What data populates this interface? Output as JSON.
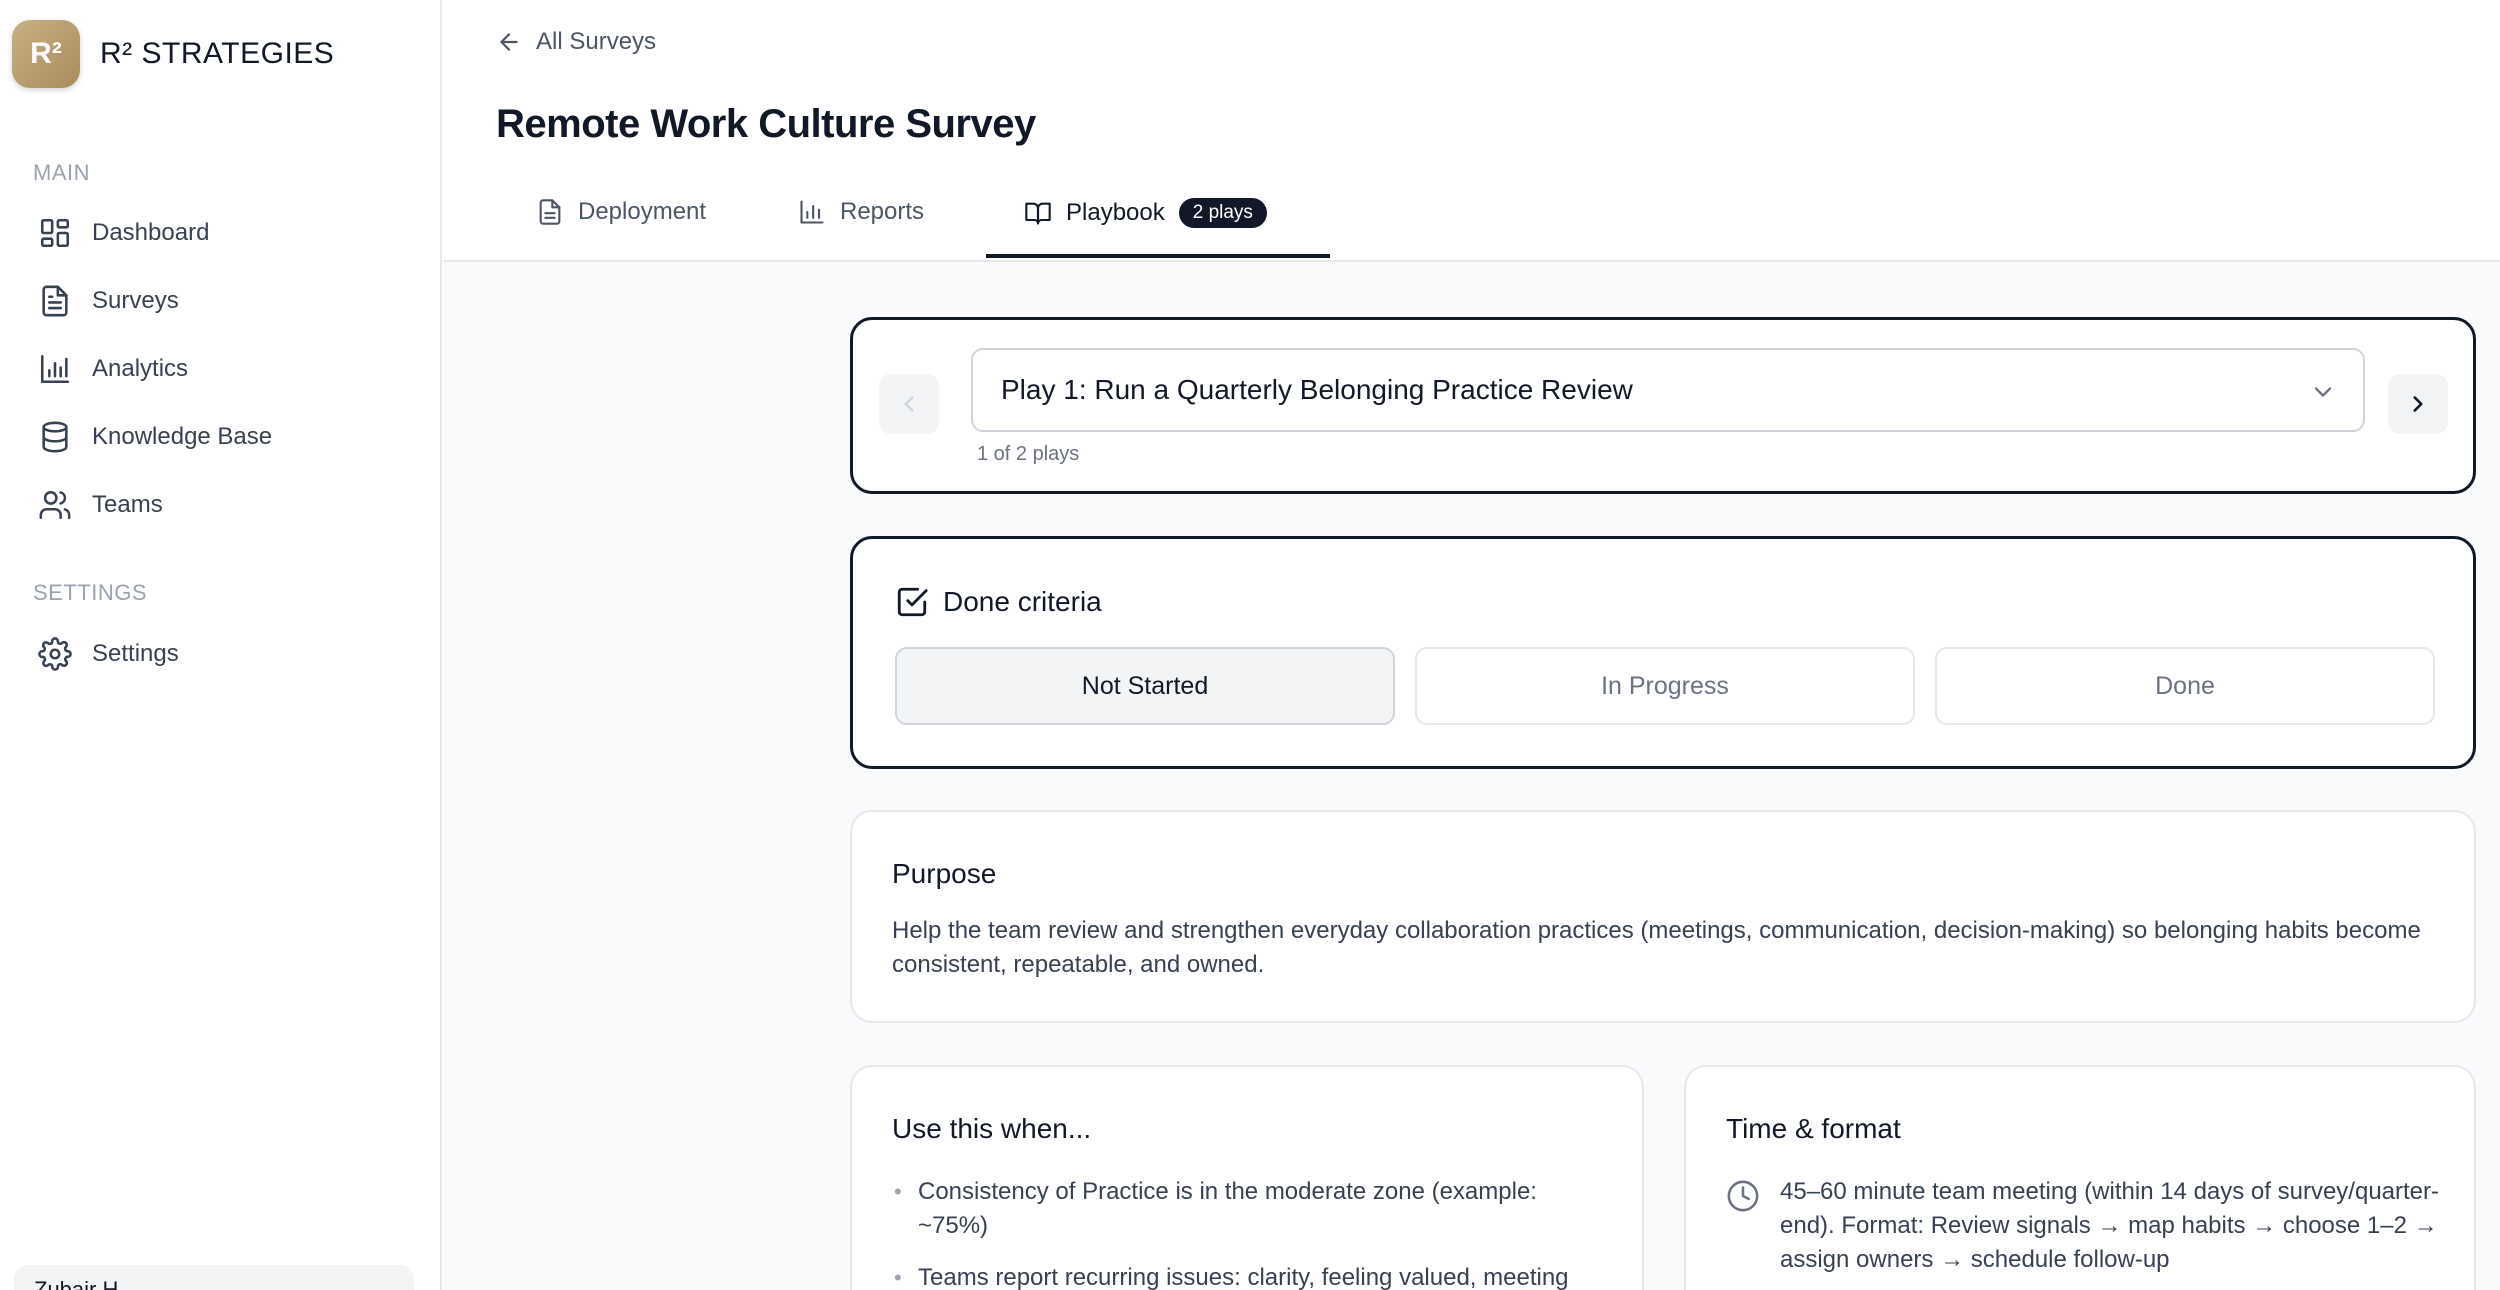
{
  "brand": {
    "logo_text": "R²",
    "name": "R² STRATEGIES"
  },
  "sidebar": {
    "main_section": "MAIN",
    "items": [
      {
        "label": "Dashboard",
        "icon": "dashboard-icon"
      },
      {
        "label": "Surveys",
        "icon": "document-icon"
      },
      {
        "label": "Analytics",
        "icon": "bar-chart-icon"
      },
      {
        "label": "Knowledge Base",
        "icon": "database-icon"
      },
      {
        "label": "Teams",
        "icon": "users-icon"
      }
    ],
    "settings_section": "SETTINGS",
    "settings_items": [
      {
        "label": "Settings",
        "icon": "gear-icon"
      }
    ],
    "user_name": "Zubair H..."
  },
  "header": {
    "back_label": "All Surveys",
    "title": "Remote Work Culture Survey",
    "tabs": [
      {
        "label": "Deployment",
        "icon": "document-icon"
      },
      {
        "label": "Reports",
        "icon": "bar-chart-icon"
      },
      {
        "label": "Playbook",
        "icon": "book-icon",
        "badge": "2 plays",
        "active": true
      }
    ]
  },
  "play_selector": {
    "selected": "Play 1: Run a Quarterly Belonging Practice Review",
    "count_text": "1 of 2 plays"
  },
  "done_criteria": {
    "title": "Done criteria",
    "options": [
      "Not Started",
      "In Progress",
      "Done"
    ],
    "selected": "Not Started"
  },
  "purpose": {
    "title": "Purpose",
    "text": "Help the team review and strengthen everyday collaboration practices (meetings, communication, decision-making) so belonging habits become consistent, repeatable, and owned."
  },
  "use_when": {
    "title": "Use this when...",
    "items": [
      "Consistency of Practice is in the moderate zone (example: ~75%)",
      "Teams report recurring issues: clarity, feeling valued, meeting"
    ]
  },
  "time_format": {
    "title": "Time & format",
    "text": "45–60 minute team meeting (within 14 days of survey/quarter-end). Format: Review signals → map habits → choose 1–2 → assign owners → schedule follow-up"
  },
  "colors": {
    "accent": "#111827",
    "muted": "#6b7280",
    "brand_gold": "#b89a6a"
  }
}
